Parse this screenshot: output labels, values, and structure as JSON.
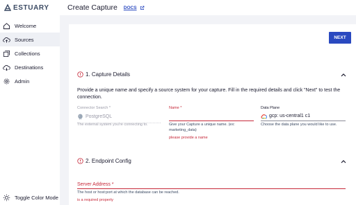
{
  "header": {
    "logo_text": "ESTUARY",
    "page_title": "Create Capture",
    "docs_label": "DOCS"
  },
  "sidebar": {
    "items": [
      {
        "label": "Welcome",
        "icon": "home-icon"
      },
      {
        "label": "Sources",
        "icon": "cloud-upload-icon"
      },
      {
        "label": "Collections",
        "icon": "collections-icon"
      },
      {
        "label": "Destinations",
        "icon": "cloud-download-icon"
      },
      {
        "label": "Admin",
        "icon": "gear-icon"
      }
    ],
    "toggle_color_mode": "Toggle Color Mode"
  },
  "main": {
    "next_label": "NEXT",
    "capture_details": {
      "title": "1. Capture Details",
      "description": "Provide a unique name and specify a source system for your capture. Fill in the required details and click \"Next\" to test the connection.",
      "connector": {
        "label": "Connector Search *",
        "value": "PostgreSQL",
        "helper": "The external system you're connecting to."
      },
      "name": {
        "label": "Name *",
        "value": "",
        "helper": "Give your Capture a unique name. (ex: marketing_data)",
        "error": "please provide a name"
      },
      "data_plane": {
        "label": "Data Plane",
        "value": "gcp: us-central1 c1",
        "helper": "Choose the data plane you would like to use."
      }
    },
    "endpoint_config": {
      "title": "2. Endpoint Config",
      "server_address": {
        "label": "Server Address *",
        "helper": "The host or host:port at which the database can be reached.",
        "error": "is a required property"
      }
    }
  },
  "colors": {
    "primary": "#2a49c0",
    "error": "#c62839",
    "sidebar_active": "#eef0f5",
    "background": "#f2f3f7"
  }
}
